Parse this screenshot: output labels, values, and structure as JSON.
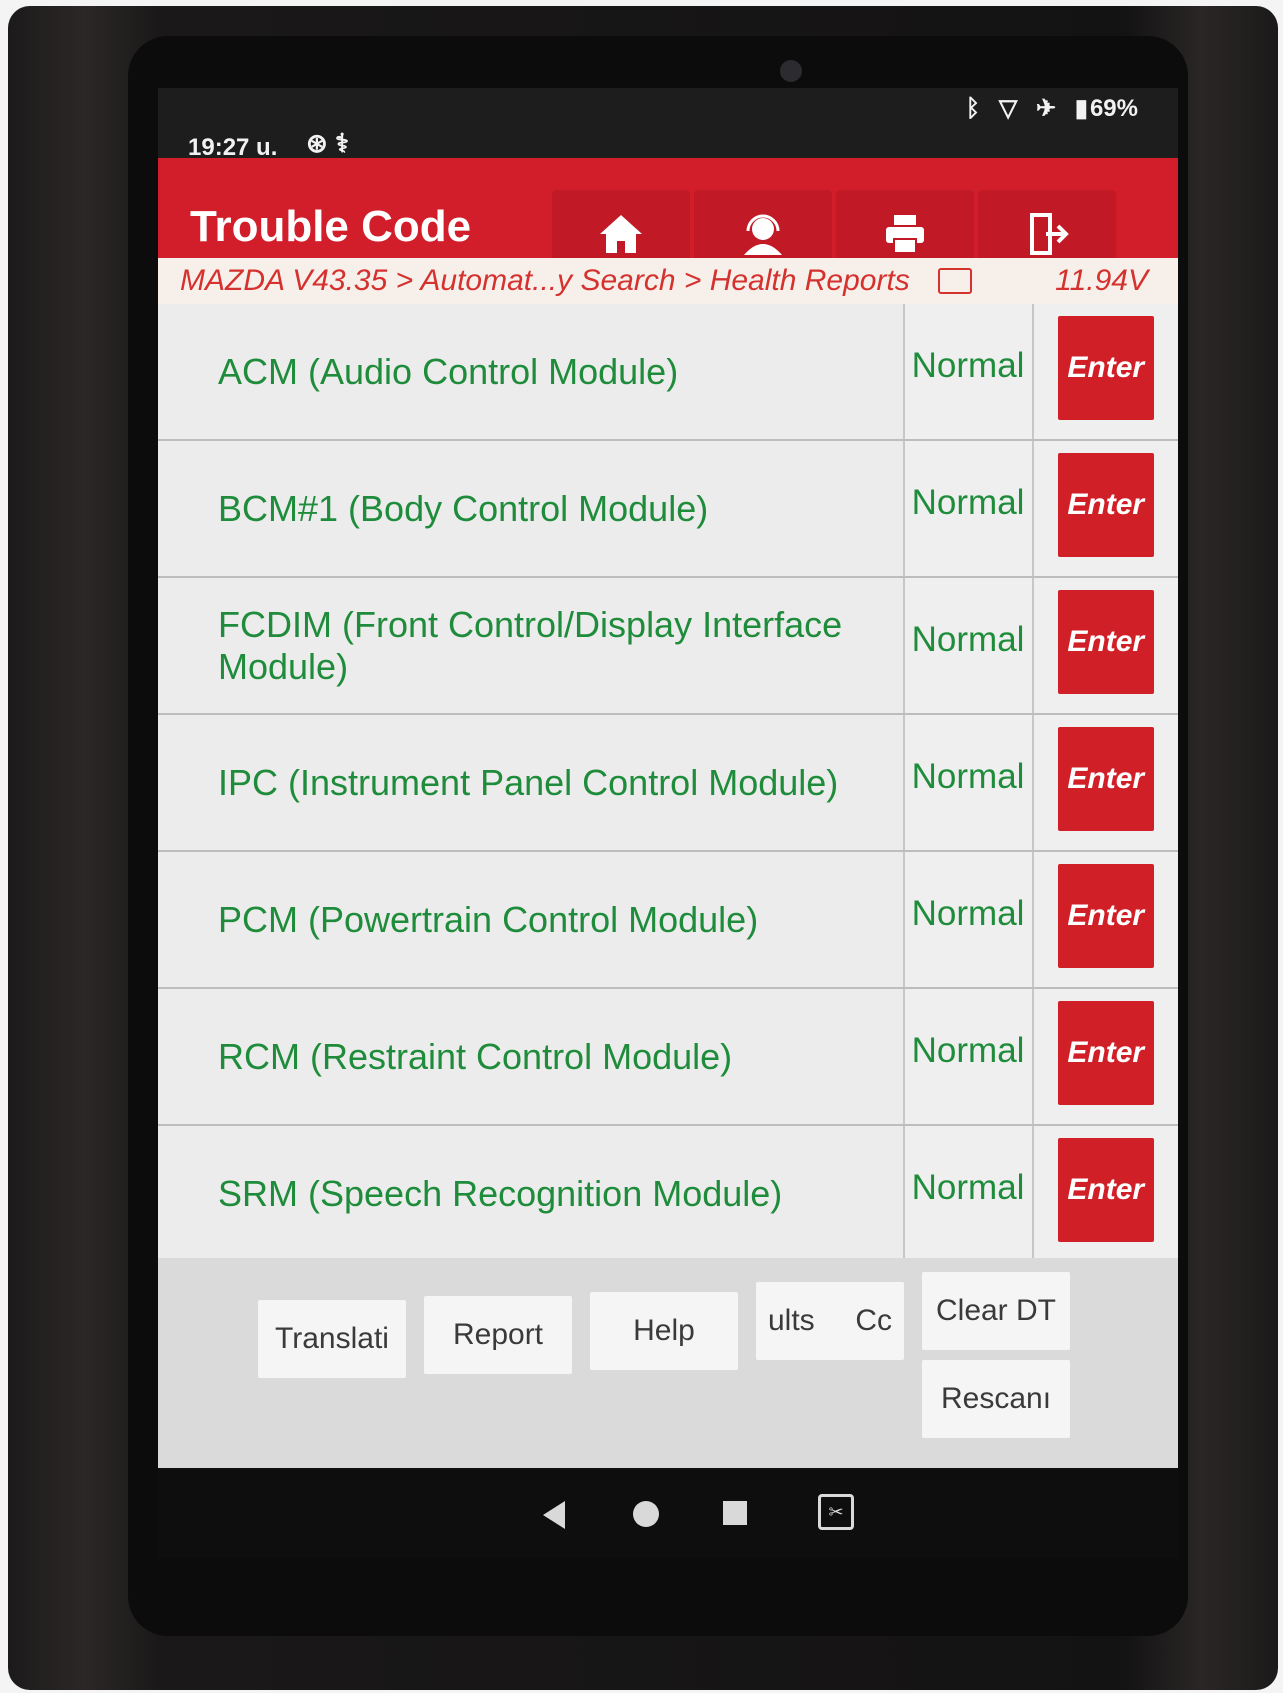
{
  "status_bar": {
    "time": "19:27 u.",
    "battery": "69%"
  },
  "header": {
    "title": "Trouble Code",
    "toolbar": {
      "home_icon": "home-icon",
      "support_icon": "headset-icon",
      "print_icon": "printer-icon",
      "exit_icon": "exit-door-icon"
    }
  },
  "breadcrumb": {
    "path": "MAZDA V43.35 > Automat...y Search > Health Reports",
    "voltage": "11.94V"
  },
  "modules": [
    {
      "name": "ACM (Audio Control Module)",
      "status": "Normal",
      "action": "Enter"
    },
    {
      "name": "BCM#1 (Body Control Module)",
      "status": "Normal",
      "action": "Enter"
    },
    {
      "name": "FCDIM (Front Control/Display Interface Module)",
      "status": "Normal",
      "action": "Enter"
    },
    {
      "name": "IPC (Instrument Panel Control Module)",
      "status": "Normal",
      "action": "Enter"
    },
    {
      "name": "PCM (Powertrain Control Module)",
      "status": "Normal",
      "action": "Enter"
    },
    {
      "name": "RCM (Restraint Control Module)",
      "status": "Normal",
      "action": "Enter"
    },
    {
      "name": "SRM (Speech Recognition Module)",
      "status": "Normal",
      "action": "Enter"
    }
  ],
  "bottom_buttons": {
    "translate": "Translati",
    "report": "Report",
    "help": "Help",
    "results_left": "ults",
    "results_right": "Cc",
    "clear_dtc": "Clear DT",
    "rescan": "Rescanı"
  },
  "colors": {
    "header_red": "#d21e2b",
    "status_green": "#1f8c3b",
    "enter_red": "#d11f27"
  }
}
